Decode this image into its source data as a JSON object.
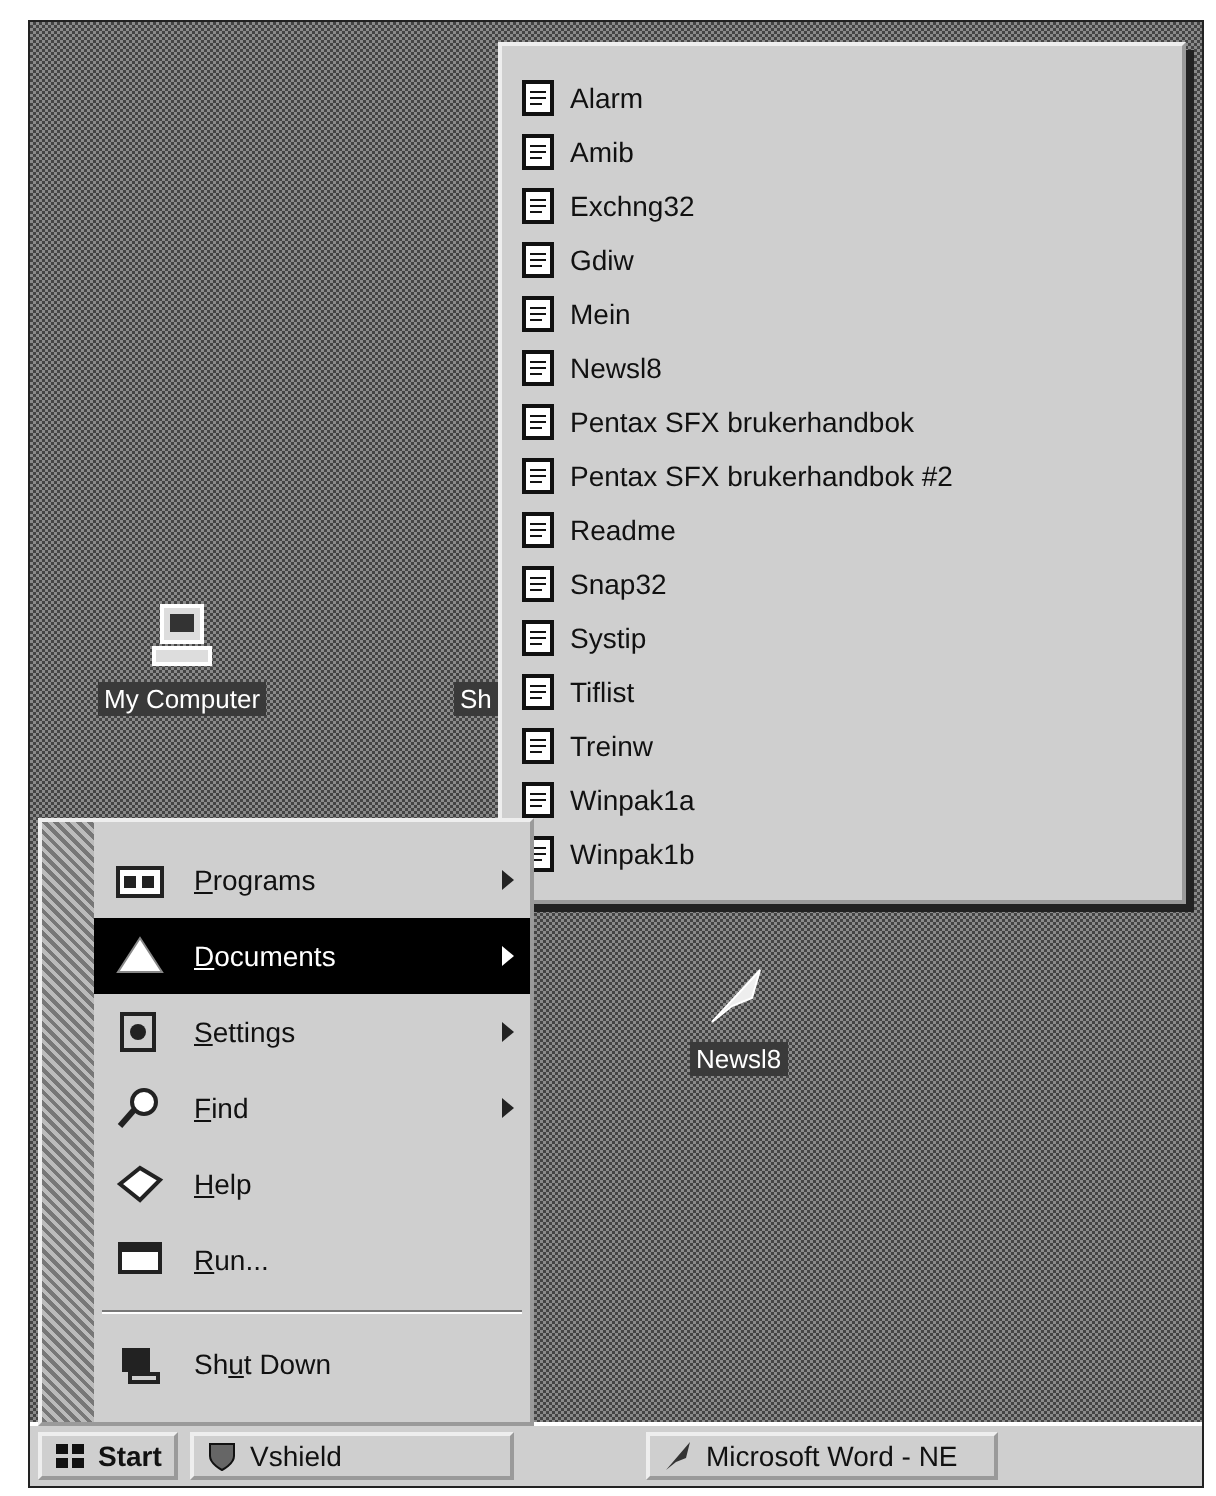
{
  "desktop": {
    "icons": [
      {
        "label": "My Computer",
        "kind": "computer"
      },
      {
        "label": "Sh",
        "kind": "none"
      },
      {
        "label": "Newsl8",
        "kind": "feather"
      }
    ]
  },
  "documents_menu": {
    "items": [
      {
        "label": "Alarm"
      },
      {
        "label": "Amib"
      },
      {
        "label": "Exchng32"
      },
      {
        "label": "Gdiw"
      },
      {
        "label": "Mein"
      },
      {
        "label": "Newsl8"
      },
      {
        "label": "Pentax SFX brukerhandbok"
      },
      {
        "label": "Pentax SFX brukerhandbok #2"
      },
      {
        "label": "Readme"
      },
      {
        "label": "Snap32"
      },
      {
        "label": "Systip"
      },
      {
        "label": "Tiflist"
      },
      {
        "label": "Treinw"
      },
      {
        "label": "Winpak1a"
      },
      {
        "label": "Winpak1b"
      }
    ]
  },
  "start_menu": {
    "items": [
      {
        "kind": "item",
        "key": "P",
        "after": "rograms",
        "submenu": true,
        "selected": false
      },
      {
        "kind": "item",
        "key": "D",
        "after": "ocuments",
        "submenu": true,
        "selected": true
      },
      {
        "kind": "item",
        "key": "S",
        "after": "ettings",
        "submenu": true,
        "selected": false
      },
      {
        "kind": "item",
        "key": "F",
        "after": "ind",
        "submenu": true,
        "selected": false
      },
      {
        "kind": "item",
        "key": "H",
        "after": "elp",
        "submenu": false,
        "selected": false
      },
      {
        "kind": "item",
        "key": "R",
        "after": "un...",
        "submenu": false,
        "selected": false
      },
      {
        "kind": "separator"
      },
      {
        "kind": "item",
        "before": "Sh",
        "key": "u",
        "after": "t Down",
        "submenu": false,
        "selected": false
      }
    ]
  },
  "taskbar": {
    "start": "Start",
    "tasks": [
      {
        "label": "Vshield"
      },
      {
        "label": "Microsoft Word - NE"
      }
    ]
  }
}
